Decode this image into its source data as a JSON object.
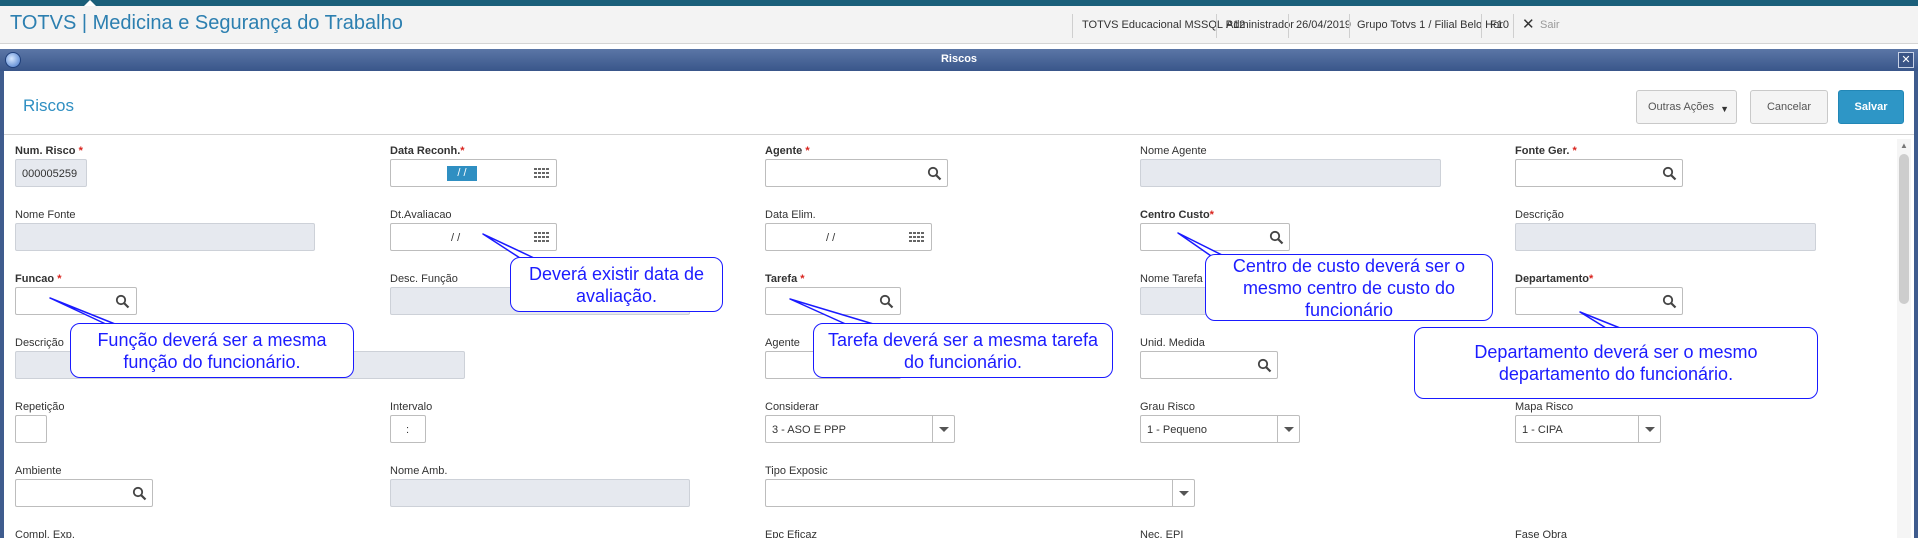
{
  "app": {
    "title": "TOTVS | Medicina e Segurança do Trabalho",
    "environment": "TOTVS Educacional MSSQL P12",
    "user": "Administrador",
    "date": "26/04/2019",
    "branch": "Grupo Totvs 1 / Filial Belo Hor",
    "shortcut": "F10",
    "exit_label": "Sair"
  },
  "window": {
    "title": "Riscos"
  },
  "form": {
    "title": "Riscos",
    "actions": {
      "more_label": "Outras Ações",
      "cancel_label": "Cancelar",
      "save_label": "Salvar"
    }
  },
  "fields": {
    "num_risco": {
      "label": "Num. Risco",
      "value": "000005259"
    },
    "data_reconh": {
      "label": "Data Reconh.",
      "value": " /  /"
    },
    "agente": {
      "label": "Agente",
      "value": ""
    },
    "nome_agente": {
      "label": "Nome Agente",
      "value": ""
    },
    "fonte_ger": {
      "label": "Fonte Ger.",
      "value": ""
    },
    "nome_fonte": {
      "label": "Nome Fonte",
      "value": ""
    },
    "dt_avaliacao": {
      "label": "Dt.Avaliacao",
      "value": "/  /"
    },
    "data_elim": {
      "label": "Data Elim.",
      "value": "/  /"
    },
    "centro_custo": {
      "label": "Centro Custo",
      "value": ""
    },
    "descricao_1": {
      "label": "Descrição",
      "value": ""
    },
    "funcao": {
      "label": "Funcao",
      "value": ""
    },
    "desc_funcao": {
      "label": "Desc. Função",
      "value": ""
    },
    "tarefa": {
      "label": "Tarefa",
      "value": ""
    },
    "nome_tarefa": {
      "label": "Nome Tarefa",
      "value": ""
    },
    "departamento": {
      "label": "Departamento",
      "value": ""
    },
    "descricao_2": {
      "label": "Descrição",
      "value": ""
    },
    "agente_2": {
      "label": "Agente",
      "value": ""
    },
    "unid_medida": {
      "label": "Unid. Medida",
      "value": ""
    },
    "repeticao": {
      "label": "Repetição",
      "value": ""
    },
    "intervalo": {
      "label": "Intervalo",
      "value": ":"
    },
    "considerar": {
      "label": "Considerar",
      "value": "3 - ASO E PPP"
    },
    "grau_risco": {
      "label": "Grau Risco",
      "value": "1 - Pequeno"
    },
    "mapa_risco": {
      "label": "Mapa Risco",
      "value": "1 - CIPA"
    },
    "ambiente": {
      "label": "Ambiente",
      "value": ""
    },
    "nome_amb": {
      "label": "Nome Amb.",
      "value": ""
    },
    "tipo_exposic": {
      "label": "Tipo Exposic",
      "value": ""
    },
    "compl_exp": {
      "label": "Compl. Exp."
    },
    "epc_eficaz": {
      "label": "Epc Eficaz"
    },
    "nec_epi": {
      "label": "Nec. EPI"
    },
    "fase_obra": {
      "label": "Fase Obra"
    }
  },
  "annotations": {
    "dt_avaliacao": "Deverá existir data de avaliação.",
    "centro_custo": "Centro de custo deverá ser o mesmo centro de custo do funcionário",
    "funcao": "Função deverá ser a mesma função do funcionário.",
    "tarefa": "Tarefa deverá ser a mesma tarefa do funcionário.",
    "departamento": "Departamento deverá ser o mesmo departamento do funcionário."
  },
  "colors": {
    "accent": "#2f8fc2",
    "required": "#d9231d",
    "callout": "#1c1cff",
    "window_bar": "#4a6698"
  }
}
